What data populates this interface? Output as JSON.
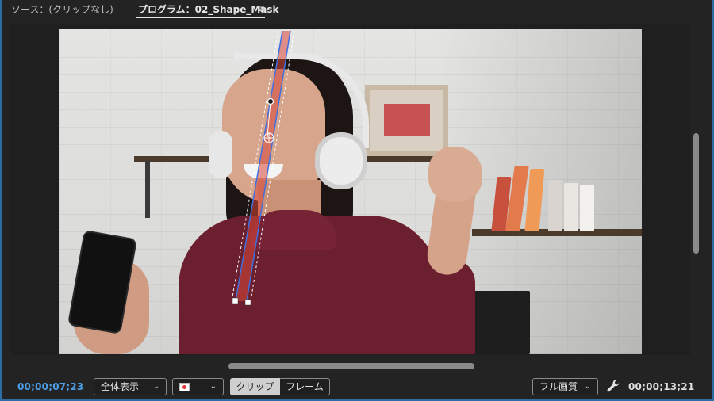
{
  "tabs": {
    "source_label": "ソース：(クリップなし)",
    "program_label": "プログラム：02_Shape_Mask",
    "panel_menu_icon": "hamburger-menu-icon"
  },
  "viewer": {
    "mask": {
      "type": "rectangle",
      "feather_handles": true
    }
  },
  "controls": {
    "current_timecode": "00;00;07;23",
    "zoom_dropdown": {
      "value": "全体表示",
      "icon": "chevron-down-icon"
    },
    "color_dropdown": {
      "icon": "chevron-down-icon",
      "swatch_color": "#e43838"
    },
    "mode": {
      "clip_label": "クリップ",
      "frame_label": "フレーム",
      "selected": "clip"
    },
    "quality_dropdown": {
      "value": "フル画質",
      "icon": "chevron-down-icon"
    },
    "settings_icon": "wrench-icon",
    "duration_timecode": "00;00;13;21"
  },
  "colors": {
    "accent_border": "#2e6da4",
    "timecode_current": "#4d9ee6",
    "mask_path": "#3f6fe0",
    "mask_fill": "#d9473a"
  }
}
